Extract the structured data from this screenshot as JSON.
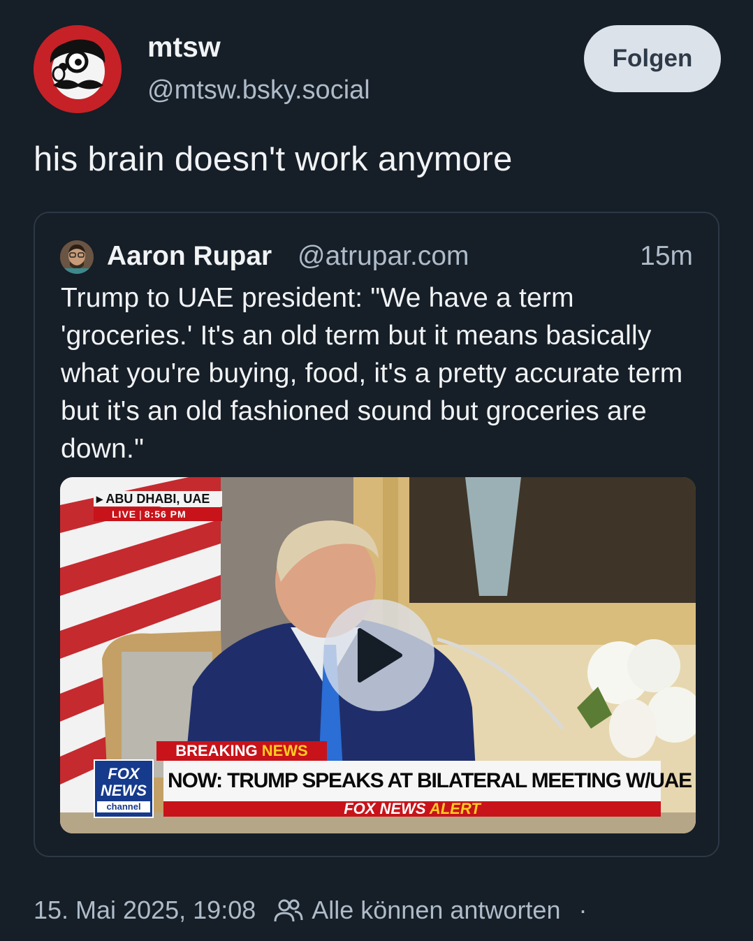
{
  "author": {
    "name": "mtsw",
    "handle": "@mtsw.bsky.social",
    "follow_label": "Folgen"
  },
  "post": {
    "text": "his brain doesn't work anymore"
  },
  "quote": {
    "name": "Aaron Rupar",
    "handle": "@atrupar.com",
    "time": "15m",
    "text": "Trump to UAE president: \"We have a term 'groceries.' It's an old term but it means basically what you're buying, food, it's a pretty accurate term but it's an old fashioned sound but groceries are down.\"",
    "video": {
      "location": "ABU DHABI, UAE",
      "live": "LIVE",
      "live_time": "8:56 PM",
      "breaking_1": "BREAKING",
      "breaking_2": "NEWS",
      "headline": "NOW: TRUMP SPEAKS AT BILATERAL MEETING W/UAE PRES",
      "alert_1": "FOX NEWS",
      "alert_2": "ALERT",
      "logo_1": "FOX",
      "logo_2": "NEWS",
      "logo_3": "channel"
    }
  },
  "footer": {
    "date": "15. Mai 2025, 19:08",
    "reply_setting": "Alle können antworten",
    "dot": "·"
  },
  "colors": {
    "background": "#161e27",
    "muted_text": "#aebbc9",
    "follow_bg": "#dce2ea",
    "fox_red": "#c8131a",
    "fox_blue": "#163a8c"
  }
}
